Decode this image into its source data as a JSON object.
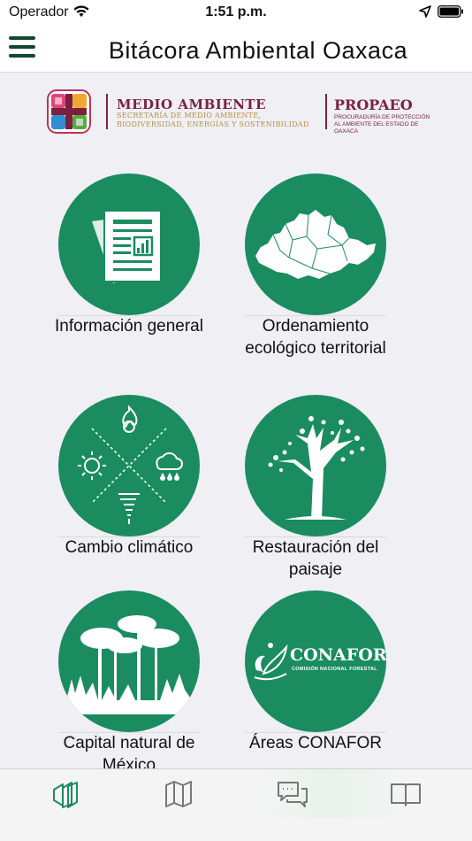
{
  "status_bar": {
    "carrier": "Operador",
    "time": "1:51 p.m."
  },
  "nav": {
    "title": "Bitácora Ambiental Oaxaca",
    "menu_icon": "hamburger-menu-icon"
  },
  "banner": {
    "main_title": "MEDIO AMBIENTE",
    "main_subtitle": "SECRETARÍA DE MEDIO AMBIENTE, BIODIVERSIDAD, ENERGÍAS Y SOSTENIBILIDAD",
    "agency_title": "PROPAEO",
    "agency_subtitle": "PROCURADURÍA DE PROTECCIÓN AL AMBIENTE DEL ESTADO DE OAXACA",
    "brand_color": "#7b2140",
    "accent_color": "#b48f45"
  },
  "tiles": [
    {
      "label": "Información general",
      "icon": "document-report-icon"
    },
    {
      "label": "Ordenamiento ecológico territorial",
      "icon": "oaxaca-map-icon"
    },
    {
      "label": "Cambio climático",
      "icon": "climate-icon"
    },
    {
      "label": "Restauración del paisaje",
      "icon": "tree-icon"
    },
    {
      "label": "Capital natural de México",
      "icon": "forest-icon"
    },
    {
      "label": "Áreas CONAFOR",
      "icon": "conafor-logo-icon"
    }
  ],
  "conafor": {
    "name": "CONAFOR",
    "subtitle": "COMISIÓN NACIONAL FORESTAL"
  },
  "tab_bar": [
    {
      "icon": "bitacora-icon",
      "active": true
    },
    {
      "icon": "map-icon",
      "active": false
    },
    {
      "icon": "chat-icon",
      "active": false
    },
    {
      "icon": "book-icon",
      "active": false
    }
  ],
  "colors": {
    "primary_green": "#1a8c60",
    "dark_green": "#14472f",
    "background": "#efeff4"
  }
}
